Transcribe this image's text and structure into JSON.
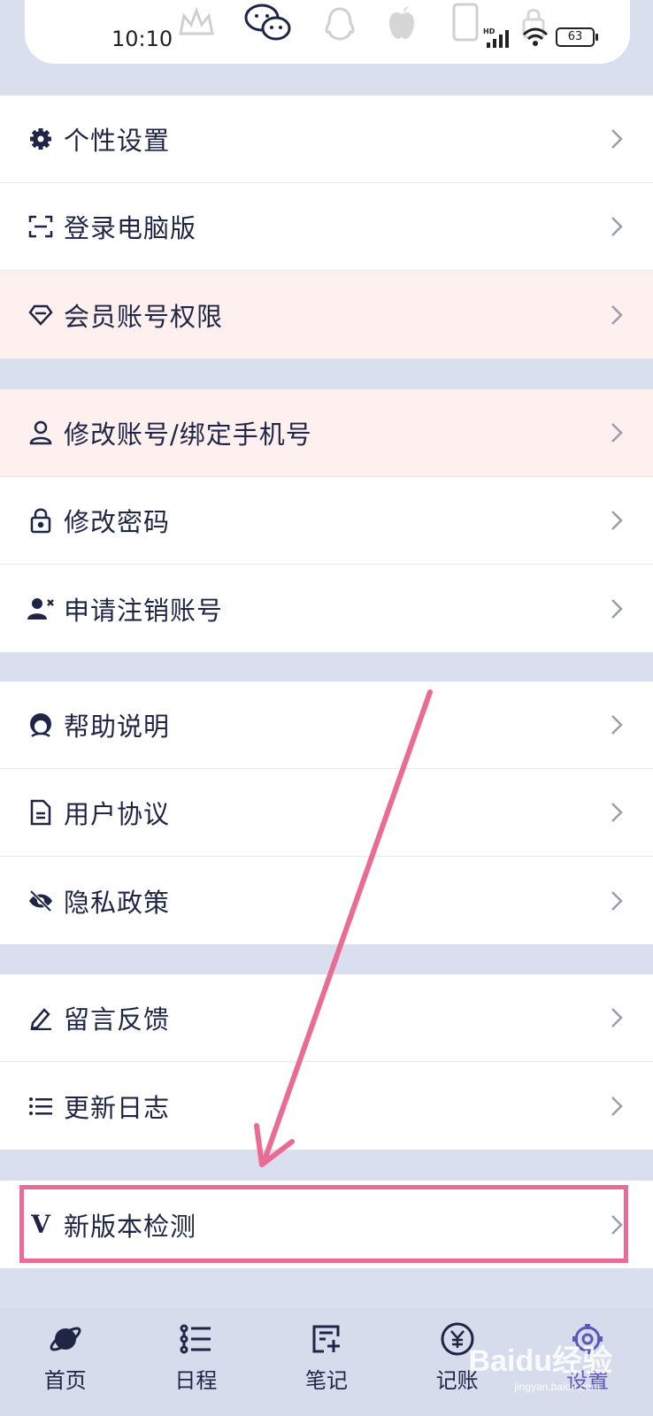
{
  "status": {
    "time": "10:10",
    "battery": "63",
    "network": "HD"
  },
  "groups": [
    {
      "items": [
        {
          "label": "个性设置",
          "icon": "gear-icon"
        },
        {
          "label": "登录电脑版",
          "icon": "scan-icon"
        },
        {
          "label": "会员账号权限",
          "icon": "diamond-icon"
        }
      ]
    },
    {
      "items": [
        {
          "label": "修改账号/绑定手机号",
          "icon": "user-icon"
        },
        {
          "label": "修改密码",
          "icon": "lock-icon"
        },
        {
          "label": "申请注销账号",
          "icon": "user-remove-icon"
        }
      ]
    },
    {
      "items": [
        {
          "label": "帮助说明",
          "icon": "help-person-icon"
        },
        {
          "label": "用户协议",
          "icon": "document-icon"
        },
        {
          "label": "隐私政策",
          "icon": "eye-off-icon"
        }
      ]
    },
    {
      "items": [
        {
          "label": "留言反馈",
          "icon": "pencil-icon"
        },
        {
          "label": "更新日志",
          "icon": "list-icon"
        }
      ]
    },
    {
      "items": [
        {
          "label": "新版本检测",
          "icon": "version-icon",
          "icon_text": "V"
        }
      ]
    }
  ],
  "tabs": [
    {
      "label": "首页",
      "icon": "planet-icon"
    },
    {
      "label": "日程",
      "icon": "schedule-icon"
    },
    {
      "label": "笔记",
      "icon": "note-add-icon"
    },
    {
      "label": "记账",
      "icon": "yen-icon"
    },
    {
      "label": "设置",
      "icon": "settings-icon",
      "active": true
    }
  ],
  "watermark": {
    "text": "Baidu经验",
    "sub": "jingyan.baidu.com"
  },
  "colors": {
    "accent": "#5a58b8",
    "highlight": "#ea6b93",
    "background": "#d9dfee",
    "pink_row": "#fdf0ef"
  }
}
